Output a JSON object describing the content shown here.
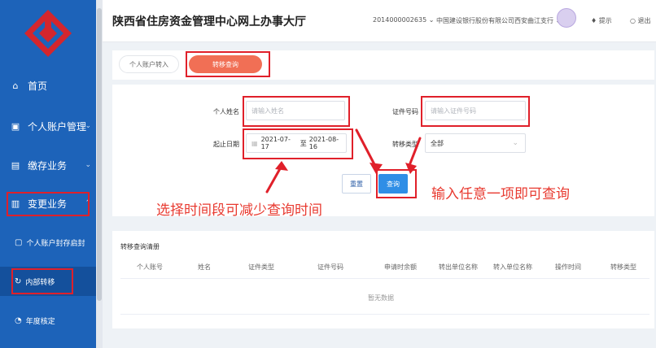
{
  "app": {
    "title": "陕西省住房资金管理中心网上办事大厅"
  },
  "header": {
    "account": "2014000002635",
    "bank": "中国建设银行股份有限公司西安曲江支行",
    "hint": "提示",
    "logout": "退出"
  },
  "sidebar": {
    "items": [
      {
        "label": "首页",
        "icon": "home-icon"
      },
      {
        "label": "个人账户管理",
        "icon": "id-card-icon"
      },
      {
        "label": "缴存业务",
        "icon": "deposit-icon"
      },
      {
        "label": "变更业务",
        "icon": "change-icon"
      }
    ],
    "subitems": [
      {
        "label": "个人账户封存启封",
        "icon": "account-seal-icon"
      },
      {
        "label": "内部转移",
        "icon": "transfer-icon"
      },
      {
        "label": "年度核定",
        "icon": "annual-icon"
      }
    ]
  },
  "tabs": [
    {
      "label": "个人账户转入",
      "active": false
    },
    {
      "label": "转移查询",
      "active": true
    }
  ],
  "form": {
    "name_label": "个人姓名",
    "name_placeholder": "请输入姓名",
    "id_label": "证件号码",
    "id_placeholder": "请输入证件号码",
    "date_label": "起止日期",
    "date_start": "2021-07-17",
    "date_sep": "至",
    "date_end": "2021-08-16",
    "type_label": "转移类型",
    "type_value": "全部",
    "reset_label": "重置",
    "query_label": "查询"
  },
  "annotations": {
    "date_tip": "选择时间段可减少查询时间",
    "input_tip": "输入任意一项即可查询"
  },
  "results": {
    "title": "转移查询清册",
    "columns": [
      "个人账号",
      "姓名",
      "证件类型",
      "证件号码",
      "申请时余额",
      "转出单位名称",
      "转入单位名称",
      "操作时间",
      "转移类型"
    ],
    "empty_text": "暂无数据"
  },
  "colors": {
    "sidebar": "#1d63b9",
    "accent_tab": "#f16f55",
    "primary_button": "#2f8ee6",
    "annotation": "#e83a30"
  }
}
